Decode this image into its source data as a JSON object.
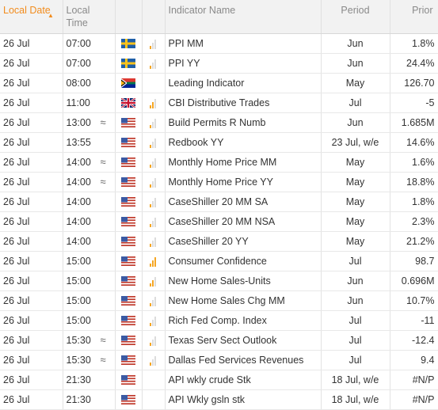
{
  "header": {
    "date_label": "Local Date",
    "time_label": "Local Time",
    "indicator_label": "Indicator Name",
    "period_label": "Period",
    "prior_label": "Prior"
  },
  "rows": [
    {
      "date": "26 Jul",
      "time": "07:00",
      "approx": false,
      "flag": "flag-sweden",
      "importance": 1,
      "name": "PPI MM",
      "period": "Jun",
      "prior": "1.8%"
    },
    {
      "date": "26 Jul",
      "time": "07:00",
      "approx": false,
      "flag": "flag-sweden",
      "importance": 1,
      "name": "PPI YY",
      "period": "Jun",
      "prior": "24.4%"
    },
    {
      "date": "26 Jul",
      "time": "08:00",
      "approx": false,
      "flag": "flag-south-africa",
      "importance": 0,
      "name": "Leading Indicator",
      "period": "May",
      "prior": "126.70"
    },
    {
      "date": "26 Jul",
      "time": "11:00",
      "approx": false,
      "flag": "flag-uk",
      "importance": 2,
      "name": "CBI Distributive Trades",
      "period": "Jul",
      "prior": "-5"
    },
    {
      "date": "26 Jul",
      "time": "13:00",
      "approx": true,
      "flag": "flag-us",
      "importance": 1,
      "name": "Build Permits R Numb",
      "period": "Jun",
      "prior": "1.685M"
    },
    {
      "date": "26 Jul",
      "time": "13:55",
      "approx": false,
      "flag": "flag-us",
      "importance": 1,
      "name": "Redbook YY",
      "period": "23 Jul, w/e",
      "prior": "14.6%"
    },
    {
      "date": "26 Jul",
      "time": "14:00",
      "approx": true,
      "flag": "flag-us",
      "importance": 1,
      "name": "Monthly Home Price MM",
      "period": "May",
      "prior": "1.6%"
    },
    {
      "date": "26 Jul",
      "time": "14:00",
      "approx": true,
      "flag": "flag-us",
      "importance": 1,
      "name": "Monthly Home Price YY",
      "period": "May",
      "prior": "18.8%"
    },
    {
      "date": "26 Jul",
      "time": "14:00",
      "approx": false,
      "flag": "flag-us",
      "importance": 1,
      "name": "CaseShiller 20 MM SA",
      "period": "May",
      "prior": "1.8%"
    },
    {
      "date": "26 Jul",
      "time": "14:00",
      "approx": false,
      "flag": "flag-us",
      "importance": 1,
      "name": "CaseShiller 20 MM NSA",
      "period": "May",
      "prior": "2.3%"
    },
    {
      "date": "26 Jul",
      "time": "14:00",
      "approx": false,
      "flag": "flag-us",
      "importance": 1,
      "name": "CaseShiller 20 YY",
      "period": "May",
      "prior": "21.2%"
    },
    {
      "date": "26 Jul",
      "time": "15:00",
      "approx": false,
      "flag": "flag-us",
      "importance": 3,
      "name": "Consumer Confidence",
      "period": "Jul",
      "prior": "98.7"
    },
    {
      "date": "26 Jul",
      "time": "15:00",
      "approx": false,
      "flag": "flag-us",
      "importance": 2,
      "name": "New Home Sales-Units",
      "period": "Jun",
      "prior": "0.696M"
    },
    {
      "date": "26 Jul",
      "time": "15:00",
      "approx": false,
      "flag": "flag-us",
      "importance": 1,
      "name": "New Home Sales Chg MM",
      "period": "Jun",
      "prior": "10.7%"
    },
    {
      "date": "26 Jul",
      "time": "15:00",
      "approx": false,
      "flag": "flag-us",
      "importance": 1,
      "name": "Rich Fed Comp. Index",
      "period": "Jul",
      "prior": "-11"
    },
    {
      "date": "26 Jul",
      "time": "15:30",
      "approx": true,
      "flag": "flag-us",
      "importance": 1,
      "name": "Texas Serv Sect Outlook",
      "period": "Jul",
      "prior": "-12.4"
    },
    {
      "date": "26 Jul",
      "time": "15:30",
      "approx": true,
      "flag": "flag-us",
      "importance": 1,
      "name": "Dallas Fed Services Revenues",
      "period": "Jul",
      "prior": "9.4"
    },
    {
      "date": "26 Jul",
      "time": "21:30",
      "approx": false,
      "flag": "flag-us",
      "importance": 0,
      "name": "API wkly crude Stk",
      "period": "18 Jul, w/e",
      "prior": "#N/P"
    },
    {
      "date": "26 Jul",
      "time": "21:30",
      "approx": false,
      "flag": "flag-us",
      "importance": 0,
      "name": "API Wkly gsln stk",
      "period": "18 Jul, w/e",
      "prior": "#N/P"
    }
  ],
  "approx_symbol": "≈",
  "colors": {
    "accent": "#f28c1d",
    "importance_on": "#f5a623",
    "importance_off": "#dcdcdc",
    "header_bg": "#f2f2f2"
  }
}
